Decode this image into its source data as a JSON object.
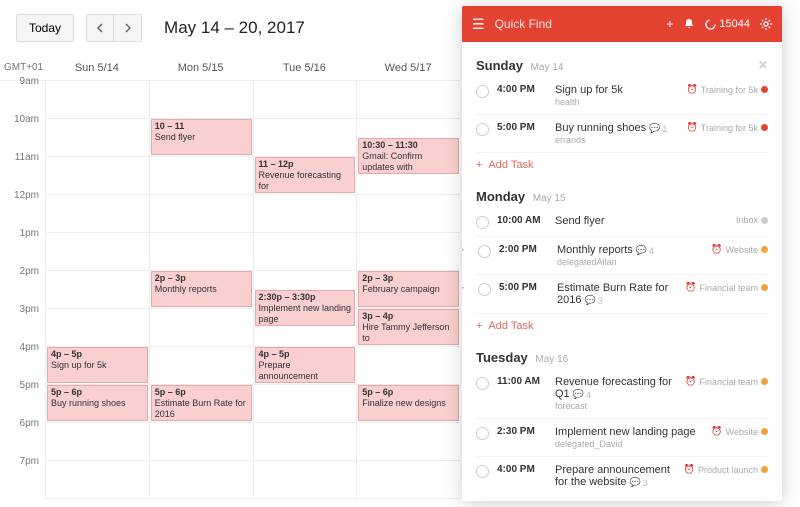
{
  "calendar": {
    "today_label": "Today",
    "range": "May 14 – 20, 2017",
    "tz": "GMT+01",
    "days": [
      "Sun 5/14",
      "Mon 5/15",
      "Tue 5/16",
      "Wed 5/17"
    ],
    "hours": [
      "9am",
      "10am",
      "11am",
      "12pm",
      "1pm",
      "2pm",
      "3pm",
      "4pm",
      "5pm",
      "6pm",
      "7pm"
    ],
    "events": {
      "mon_send_flyer": {
        "time": "10 – 11",
        "title": "Send flyer"
      },
      "tue_revenue": {
        "time": "11 – 12p",
        "title": "Revenue forecasting for"
      },
      "wed_gmail": {
        "time": "10:30 – 11:30",
        "title": "Gmail: Confirm updates with"
      },
      "mon_monthly": {
        "time": "2p – 3p",
        "title": "Monthly reports"
      },
      "tue_landing": {
        "time": "2:30p – 3:30p",
        "title": "Implement new landing page"
      },
      "wed_feb": {
        "time": "2p – 3p",
        "title": "February campaign"
      },
      "wed_hire": {
        "time": "3p – 4p",
        "title": "Hire Tammy Jefferson to"
      },
      "sun_signup": {
        "time": "4p – 5p",
        "title": "Sign up for 5k"
      },
      "tue_prepare": {
        "time": "4p – 5p",
        "title": "Prepare announcement"
      },
      "sun_shoes": {
        "time": "5p – 6p",
        "title": "Buy running shoes"
      },
      "mon_burn": {
        "time": "5p – 6p",
        "title": "Estimate Burn Rate for 2016"
      },
      "wed_finalize": {
        "time": "5p – 6p",
        "title": "Finalize new designs"
      }
    }
  },
  "sidebar": {
    "quick_find": "Quick Find",
    "karma": "15044",
    "add_task": "Add Task",
    "days": {
      "sun": {
        "name": "Sunday",
        "date": "May 14"
      },
      "mon": {
        "name": "Monday",
        "date": "May 15"
      },
      "tue": {
        "name": "Tuesday",
        "date": "May 16"
      }
    },
    "tasks": {
      "sun1": {
        "time": "4:00 PM",
        "title": "Sign up for 5k",
        "sub": "health",
        "label": "Training for 5k"
      },
      "sun2": {
        "time": "5:00 PM",
        "title": "Buy running shoes",
        "sub": "errands",
        "comments": "1",
        "label": "Training for 5k"
      },
      "mon1": {
        "time": "10:00 AM",
        "title": "Send flyer",
        "label": "Inbox"
      },
      "mon2": {
        "time": "2:00 PM",
        "title": "Monthly reports",
        "sub": "delegatedAllan",
        "comments": "4",
        "label": "Website"
      },
      "mon3": {
        "time": "5:00 PM",
        "title": "Estimate Burn Rate for 2016",
        "comments": "3",
        "label": "Financial team"
      },
      "tue1": {
        "time": "11:00 AM",
        "title": "Revenue forecasting for Q1",
        "sub": "forecast",
        "comments": "4",
        "label": "Financial team"
      },
      "tue2": {
        "time": "2:30 PM",
        "title": "Implement new landing page",
        "sub": "delegated_David",
        "label": "Website"
      },
      "tue3": {
        "time": "4:00 PM",
        "title": "Prepare announcement for the website",
        "comments": "3",
        "label": "Product launch"
      }
    }
  }
}
